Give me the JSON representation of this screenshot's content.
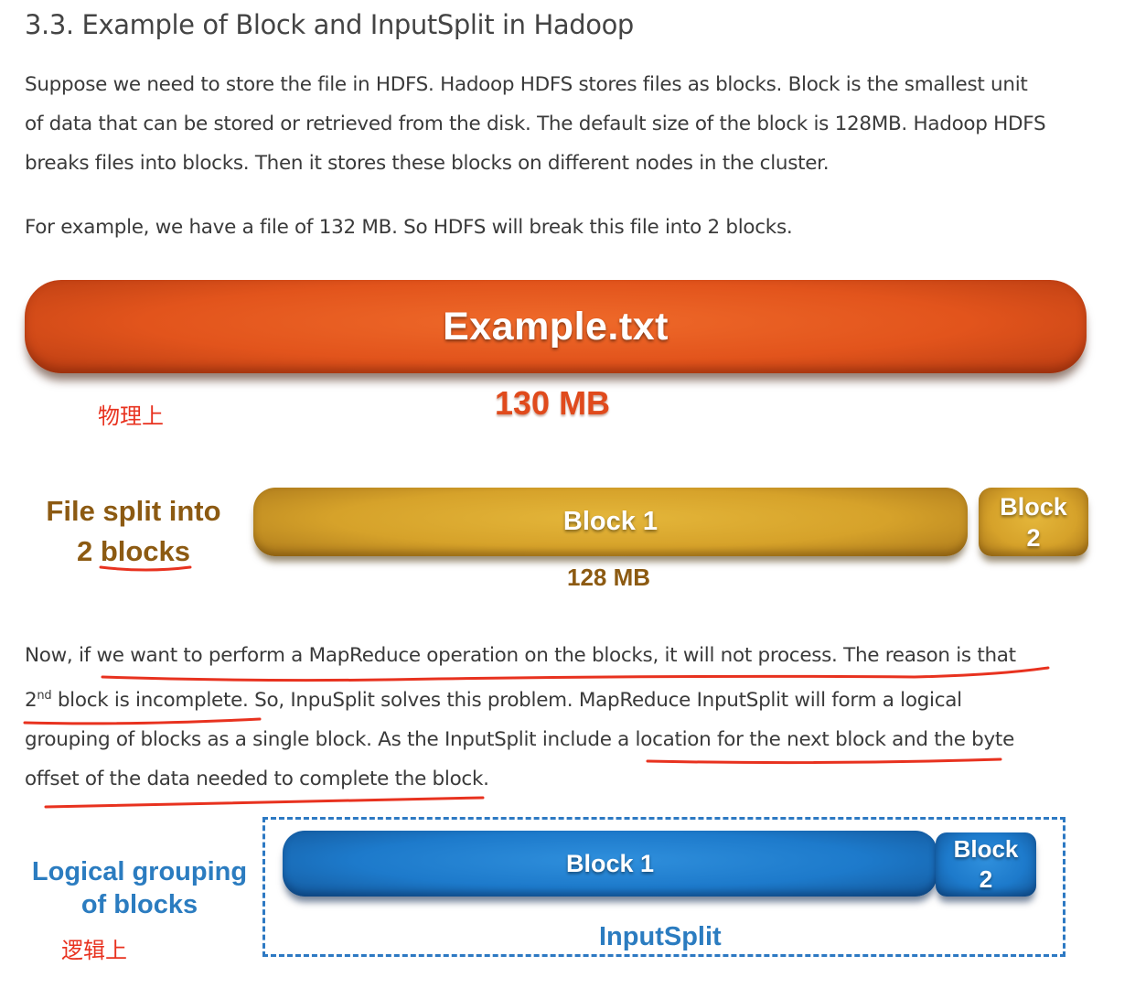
{
  "heading": "3.3. Example of Block and InputSplit in Hadoop",
  "paragraph1": [
    "Suppose we need to store the file in HDFS.  Hadoop HDFS stores files as blocks. Block is the smallest unit",
    "of data that can be stored or retrieved from the disk. The default size of the block is 128MB. Hadoop HDFS",
    "breaks files into blocks. Then it stores these blocks on different nodes in the cluster."
  ],
  "paragraph2": "For example, we have a file of 132 MB. So HDFS will break this file into 2 blocks.",
  "figure1": {
    "file_name": "Example.txt",
    "file_size": "130 MB",
    "annotation_physical": "物理上",
    "split_label_line1": "File split into",
    "split_label_line2": "2 blocks",
    "block1_label": "Block 1",
    "block2_label_line1": "Block",
    "block2_label_line2": "2",
    "block1_size": "128 MB"
  },
  "paragraph3": {
    "line1": "Now, if we want to perform a MapReduce operation on the blocks, it will not process. The reason is that",
    "line2_prefix": "2",
    "line2_sup": "nd",
    "line2_rest": " block is incomplete. So, InpuSplit solves this problem. MapReduce InputSplit will form a logical",
    "line3": "grouping of blocks as a single block. As the InputSplit include a location for the next block and the byte",
    "line4": "offset of the data needed to complete the block."
  },
  "figure2": {
    "label_line1": "Logical grouping",
    "label_line2": "of blocks",
    "annotation_logical": "逻辑上",
    "block1_label": "Block 1",
    "block2_label_line1": "Block",
    "block2_label_line2": "2",
    "container_label": "InputSplit"
  },
  "colors": {
    "file_bar": "#e2541c",
    "gold_block": "#d6a22a",
    "gold_text": "#8c5a12",
    "blue_block": "#1d7acb",
    "blue_text": "#2b7cc0",
    "annotation_red": "#e8321f"
  }
}
